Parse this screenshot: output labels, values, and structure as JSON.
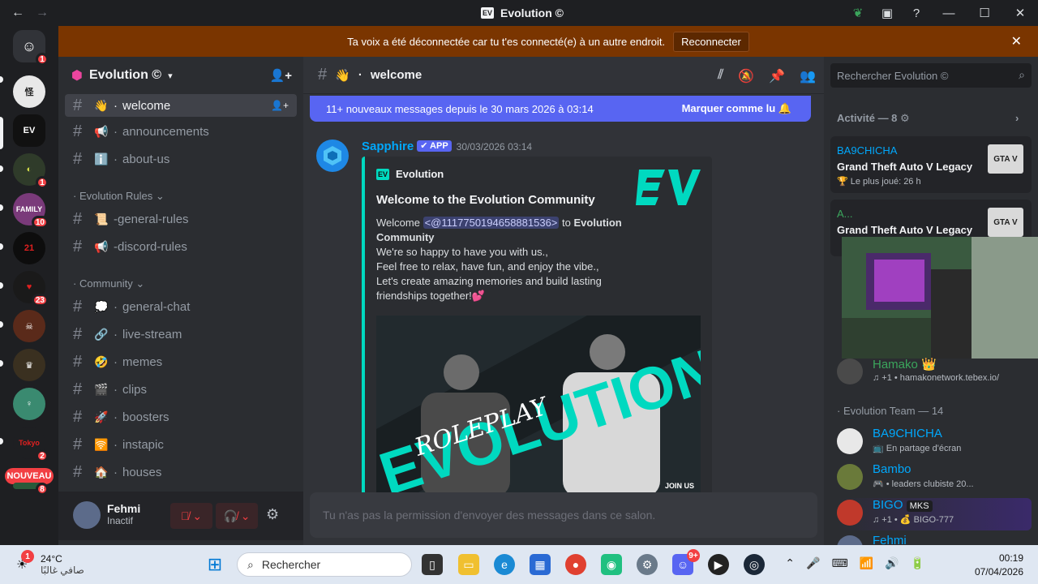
{
  "window": {
    "title": "Evolution ©",
    "back": "←",
    "forward": "→"
  },
  "banner": {
    "text": "Ta voix a été déconnectée car tu t'es connecté(e) à un autre endroit.",
    "button": "Reconnecter"
  },
  "server_rail": {
    "badges": [
      "1",
      "1",
      "10",
      "23",
      "2",
      "8"
    ],
    "new_label": "NOUVEAU"
  },
  "server": {
    "name": "Evolution ©"
  },
  "channels": {
    "top": [
      {
        "emoji": "👋",
        "name": "welcome"
      },
      {
        "emoji": "📢",
        "name": "announcements"
      },
      {
        "emoji": "ℹ️",
        "name": "about-us"
      }
    ],
    "cat_rules": "Evolution Rules",
    "rules": [
      {
        "emoji": "📜",
        "name": "-general-rules"
      },
      {
        "emoji": "📢",
        "name": "-discord-rules"
      }
    ],
    "cat_community": "Community",
    "community": [
      {
        "emoji": "💭",
        "name": "general-chat"
      },
      {
        "emoji": "🔗",
        "name": "live-stream"
      },
      {
        "emoji": "🤣",
        "name": "memes"
      },
      {
        "emoji": "🎬",
        "name": "clips"
      },
      {
        "emoji": "🚀",
        "name": "boosters"
      },
      {
        "emoji": "🛜",
        "name": "instapic"
      },
      {
        "emoji": "🏠",
        "name": "houses"
      }
    ]
  },
  "user": {
    "name": "Fehmi",
    "status": "Inactif"
  },
  "channel_header": {
    "emoji": "👋",
    "name": "welcome"
  },
  "new_messages": {
    "text": "11+ nouveaux messages depuis le 30 mars 2026 à 03:14",
    "mark": "Marquer comme lu"
  },
  "message": {
    "author": "Sapphire",
    "app_tag": "✔ APP",
    "timestamp": "30/03/2026 03:14",
    "embed": {
      "author": "Evolution",
      "title": "Welcome to the Evolution Community",
      "welcome": "Welcome",
      "mention": "<@1117750194658881536>",
      "to": "to",
      "community": "Evolution Community",
      "line1": "We're so happy to have you with us.,",
      "line2": "Feel free to relax, have fun, and enjoy the vibe.,",
      "line3": "Let's create amazing memories and build lasting friendships together!💕",
      "image_text": "EVOLUTION",
      "image_script": "ROLEPLAY",
      "image_join": "JOIN US"
    }
  },
  "composer": {
    "placeholder": "Tu n'as pas la permission d'envoyer des messages dans ce salon."
  },
  "members": {
    "search": "Rechercher Evolution ©",
    "activity_header": "Activité — 8",
    "activity": [
      {
        "user": "BA9CHICHA",
        "game": "Grand Theft Auto V Legacy",
        "sub": "🏆 Le plus joué: 26 h"
      },
      {
        "user": "A...",
        "game": "Grand Theft Auto V Legacy",
        "sub": ""
      }
    ],
    "hamako": {
      "name": "Hamako",
      "status": "♫ +1 • hamakonetwork.tebex.io/"
    },
    "team_header": "Evolution Team — 14",
    "team": [
      {
        "name": "BA9CHICHA",
        "status": "📺 En partage d'écran"
      },
      {
        "name": "Bambo",
        "status": "🎮 • leaders clubiste 20..."
      },
      {
        "name": "BIGO",
        "tag": "MKS",
        "status": "♫ +1 • 💰 BIGO-777"
      },
      {
        "name": "Fehmi",
        "status": ""
      }
    ]
  },
  "taskbar": {
    "temp": "24°C",
    "weather": "صافي غالبًا",
    "weather_badge": "1",
    "search": "Rechercher",
    "discord_badge": "9+",
    "time": "00:19",
    "date": "07/04/2026"
  }
}
